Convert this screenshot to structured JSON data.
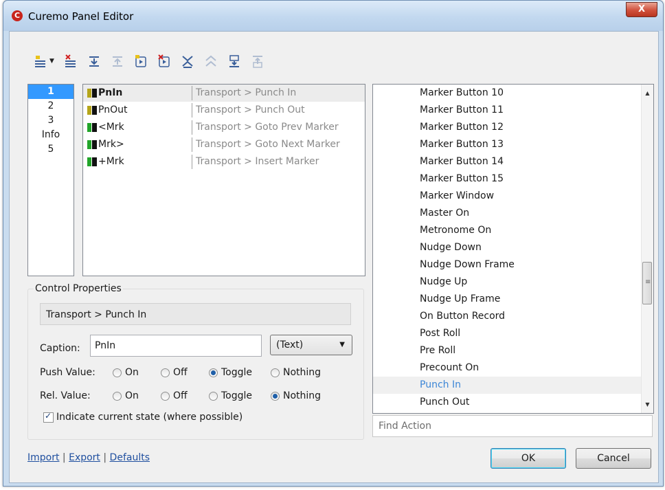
{
  "window": {
    "title": "Curemo Panel Editor",
    "close_glyph": "X",
    "icon": "curemo-app-icon"
  },
  "toolbar": {
    "buttons": [
      {
        "name": "add-control",
        "icon": "add-control-icon",
        "enabled": true,
        "dropdown": true
      },
      {
        "name": "remove-control",
        "icon": "remove-control-icon",
        "enabled": true
      },
      {
        "name": "move-down",
        "icon": "move-down-icon",
        "enabled": true
      },
      {
        "name": "move-up",
        "icon": "move-up-icon",
        "enabled": false
      },
      {
        "name": "add-page",
        "icon": "add-page-icon",
        "enabled": true
      },
      {
        "name": "remove-page",
        "icon": "remove-page-icon",
        "enabled": true
      },
      {
        "name": "page-down",
        "icon": "page-down-icon",
        "enabled": true
      },
      {
        "name": "page-up",
        "icon": "page-up-icon",
        "enabled": false
      },
      {
        "name": "move-to-bottom",
        "icon": "move-bottom-icon",
        "enabled": true
      },
      {
        "name": "move-to-top",
        "icon": "move-top-icon",
        "enabled": false
      }
    ]
  },
  "pages": [
    "1",
    "2",
    "3",
    "Info",
    "5"
  ],
  "controls": [
    {
      "name": "PnIn",
      "action": "Transport > Punch In",
      "color": "#b5a51a",
      "selected": true
    },
    {
      "name": "PnOut",
      "action": "Transport > Punch Out",
      "color": "#b5a51a",
      "selected": false
    },
    {
      "name": "<Mrk",
      "action": "Transport > Goto Prev Marker",
      "color": "#22a52a",
      "selected": false
    },
    {
      "name": "Mrk>",
      "action": "Transport > Goto Next Marker",
      "color": "#22a52a",
      "selected": false
    },
    {
      "name": "+Mrk",
      "action": "Transport > Insert Marker",
      "color": "#22a52a",
      "selected": false
    }
  ],
  "properties": {
    "legend": "Control Properties",
    "path": "Transport > Punch In",
    "caption_label": "Caption:",
    "caption_value": "PnIn",
    "caption_type": "(Text)",
    "push_label": "Push Value:",
    "release_label": "Rel. Value:",
    "options": [
      "On",
      "Off",
      "Toggle",
      "Nothing"
    ],
    "push_selected": "Toggle",
    "release_selected": "Nothing",
    "indicate_label": "Indicate current state (where possible)",
    "indicate_checked": true
  },
  "links": {
    "import": "Import",
    "export": "Export",
    "defaults": "Defaults",
    "sep": "|"
  },
  "actions": {
    "items": [
      "Marker Button 10",
      "Marker Button 11",
      "Marker Button 12",
      "Marker Button 13",
      "Marker Button 14",
      "Marker Button 15",
      "Marker Window",
      "Master On",
      "Metronome On",
      "Nudge Down",
      "Nudge Down Frame",
      "Nudge Up",
      "Nudge Up Frame",
      "On Button Record",
      "Post Roll",
      "Pre Roll",
      "Precount On",
      "Punch In",
      "Punch Out"
    ],
    "selected": "Punch In",
    "find_placeholder": "Find Action"
  },
  "buttons": {
    "ok": "OK",
    "cancel": "Cancel"
  }
}
